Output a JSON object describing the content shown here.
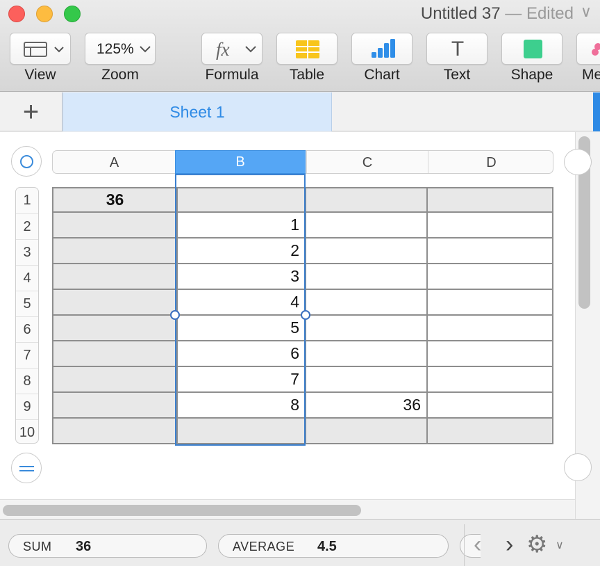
{
  "window": {
    "title": "Untitled 37",
    "status": "— Edited",
    "title_chevron": "∨"
  },
  "toolbar": {
    "view_label": "View",
    "zoom_label": "Zoom",
    "zoom_value": "125%",
    "formula_label": "Formula",
    "formula_glyph": "fx",
    "table_label": "Table",
    "chart_label": "Chart",
    "text_label": "Text",
    "text_glyph": "T",
    "shape_label": "Shape",
    "media_label": "Me",
    "dropdown_glyph": "∨"
  },
  "tabs": {
    "add_glyph": "+",
    "sheets": [
      {
        "label": "Sheet 1",
        "active": true
      }
    ]
  },
  "spreadsheet": {
    "columns": [
      "A",
      "B",
      "C",
      "D"
    ],
    "selected_column": "B",
    "rows": [
      {
        "num": "1",
        "cells": [
          "36",
          "",
          "",
          ""
        ]
      },
      {
        "num": "2",
        "cells": [
          "",
          "1",
          "",
          ""
        ]
      },
      {
        "num": "3",
        "cells": [
          "",
          "2",
          "",
          ""
        ]
      },
      {
        "num": "4",
        "cells": [
          "",
          "3",
          "",
          ""
        ]
      },
      {
        "num": "5",
        "cells": [
          "",
          "4",
          "",
          ""
        ]
      },
      {
        "num": "6",
        "cells": [
          "",
          "5",
          "",
          ""
        ]
      },
      {
        "num": "7",
        "cells": [
          "",
          "6",
          "",
          ""
        ]
      },
      {
        "num": "8",
        "cells": [
          "",
          "7",
          "",
          ""
        ]
      },
      {
        "num": "9",
        "cells": [
          "",
          "8",
          "36",
          ""
        ]
      },
      {
        "num": "10",
        "cells": [
          "",
          "",
          "",
          ""
        ]
      }
    ]
  },
  "statusbar": {
    "sum_label": "SUM",
    "sum_value": "36",
    "average_label": "AVERAGE",
    "average_value": "4.5",
    "prev_glyph": "‹",
    "next_glyph": "›",
    "gear_glyph": "⚙",
    "gear_chevron": "∨"
  },
  "colors": {
    "accent": "#2e8ae5",
    "selected_column_header": "#55a6f5",
    "header_cell_fill": "#e8e8e8",
    "sheet_tab_fill": "#d7e8fb"
  }
}
